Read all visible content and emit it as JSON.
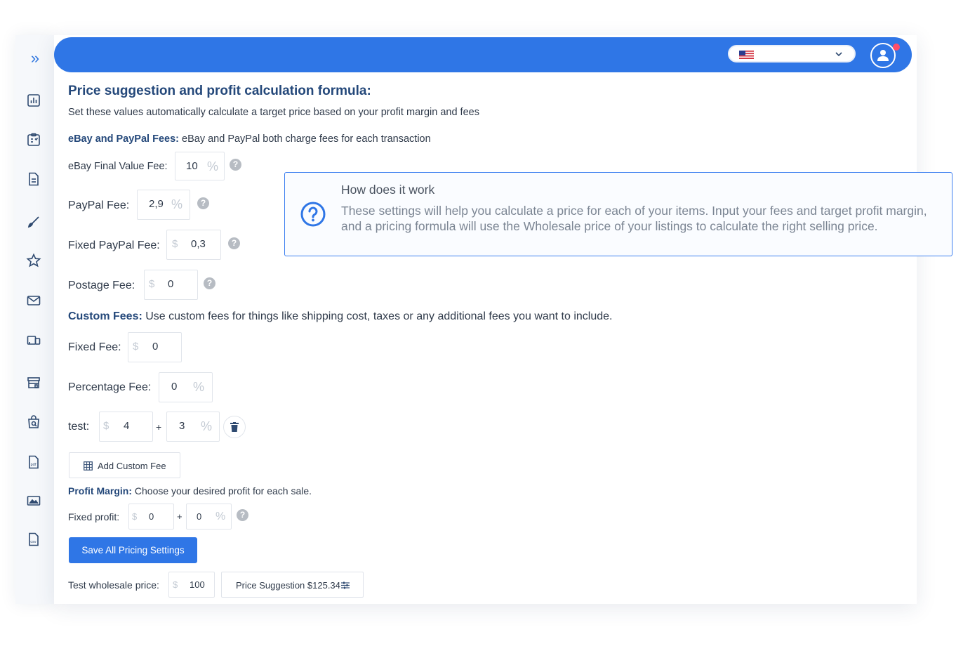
{
  "sidebar": {
    "expand_icon": "double-chevron-right-icon",
    "items": [
      {
        "icon": "bar-chart-icon"
      },
      {
        "icon": "clipboard-icon"
      },
      {
        "icon": "document-icon"
      },
      {
        "icon": "brush-icon"
      },
      {
        "icon": "star-icon"
      },
      {
        "icon": "mail-icon"
      },
      {
        "icon": "devices-icon"
      },
      {
        "icon": "store-icon"
      },
      {
        "icon": "search-bag-icon"
      },
      {
        "icon": "pdf-file-icon"
      },
      {
        "icon": "image-icon"
      },
      {
        "icon": "csv-file-icon"
      }
    ]
  },
  "topbar": {
    "language_flag": "us-flag-icon",
    "user_icon": "user-icon"
  },
  "page": {
    "title": "Price suggestion and profit calculation formula:",
    "subtitle": "Set these values automatically calculate a target price based on your profit margin and fees"
  },
  "ebay_paypal": {
    "heading": "eBay and PayPal Fees:",
    "description": " eBay and PayPal both charge fees for each transaction",
    "final_value_fee": {
      "label": "eBay Final Value Fee:",
      "value": "10",
      "suffix": "%"
    },
    "paypal_fee": {
      "label": "PayPal Fee:",
      "value": "2,9",
      "suffix": "%"
    },
    "fixed_paypal_fee": {
      "label": "Fixed PayPal Fee:",
      "prefix": "$",
      "value": "0,3"
    },
    "postage_fee": {
      "label": "Postage Fee:",
      "prefix": "$",
      "value": "0"
    }
  },
  "custom_fees": {
    "heading": "Custom Fees:",
    "description": " Use custom fees for things like shipping cost, taxes or any additional fees you want to include.",
    "fixed_fee": {
      "label": "Fixed Fee:",
      "prefix": "$",
      "value": "0"
    },
    "percentage_fee": {
      "label": "Percentage Fee:",
      "value": "0",
      "suffix": "%"
    },
    "test_fee": {
      "label": "test:",
      "prefix": "$",
      "fixed_value": "4",
      "plus": "+",
      "percent_value": "3",
      "suffix": "%"
    },
    "add_button": "Add Custom Fee"
  },
  "profit_margin": {
    "heading": "Profit Margin:",
    "description": " Choose your desired profit for each sale.",
    "fixed_profit": {
      "label": "Fixed profit:",
      "prefix": "$",
      "fixed_value": "0",
      "plus": "+",
      "percent_value": "0",
      "suffix": "%"
    }
  },
  "save_button": "Save All Pricing Settings",
  "test_wholesale": {
    "label": "Test wholesale price:",
    "prefix": "$",
    "value": "100",
    "suggestion_button": "Price Suggestion $125.34"
  },
  "help_mark": "?",
  "info": {
    "title": "How does it work",
    "text": "These settings will help you calculate a price for each of your items. Input your fees and target profit margin, and a pricing formula will use the Wholesale price of your listings to calculate the right selling price."
  },
  "colors": {
    "primary": "#2f76e6",
    "heading": "#24487a",
    "notification": "#ff4d6a"
  }
}
